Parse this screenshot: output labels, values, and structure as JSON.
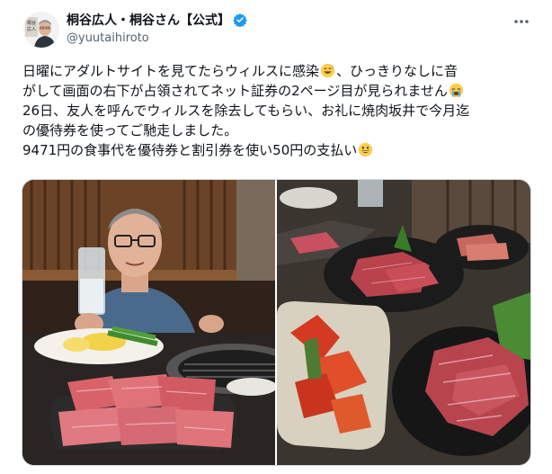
{
  "tweet": {
    "author": {
      "display_name": "桐谷広人・桐谷さん【公式】",
      "handle": "@yuutaihiroto",
      "verified": true,
      "avatar_icon": "profile-photo"
    },
    "more_icon": "more-options-icon",
    "text_lines": [
      {
        "before": "日曜にアダルトサイトを見てたらウィルスに感染",
        "emoji": "grinning-sweat-emoji",
        "after": "、ひっきりなしに音"
      },
      {
        "before": "がして画面の右下が占領されてネット証券の2ページ目が見られません",
        "emoji": "crying-emoji",
        "after": ""
      },
      {
        "before": "26日、友人を呼んでウィルスを除去してもらい、お礼に焼肉坂井で今月迄",
        "emoji": "",
        "after": ""
      },
      {
        "before": "の優待券を使ってご馳走しました。",
        "emoji": "",
        "after": ""
      },
      {
        "before": "9471円の食事代を優待券と割引券を使い50円の支払い",
        "emoji": "grinning-emoji",
        "after": ""
      }
    ],
    "media": [
      {
        "name": "photo-man-at-yakiniku-table"
      },
      {
        "name": "photo-yakiniku-dishes"
      }
    ],
    "colors": {
      "verified": "#1d9bf0",
      "handle": "#536471",
      "text": "#0f1419",
      "emoji": "#ffcc4d"
    }
  }
}
